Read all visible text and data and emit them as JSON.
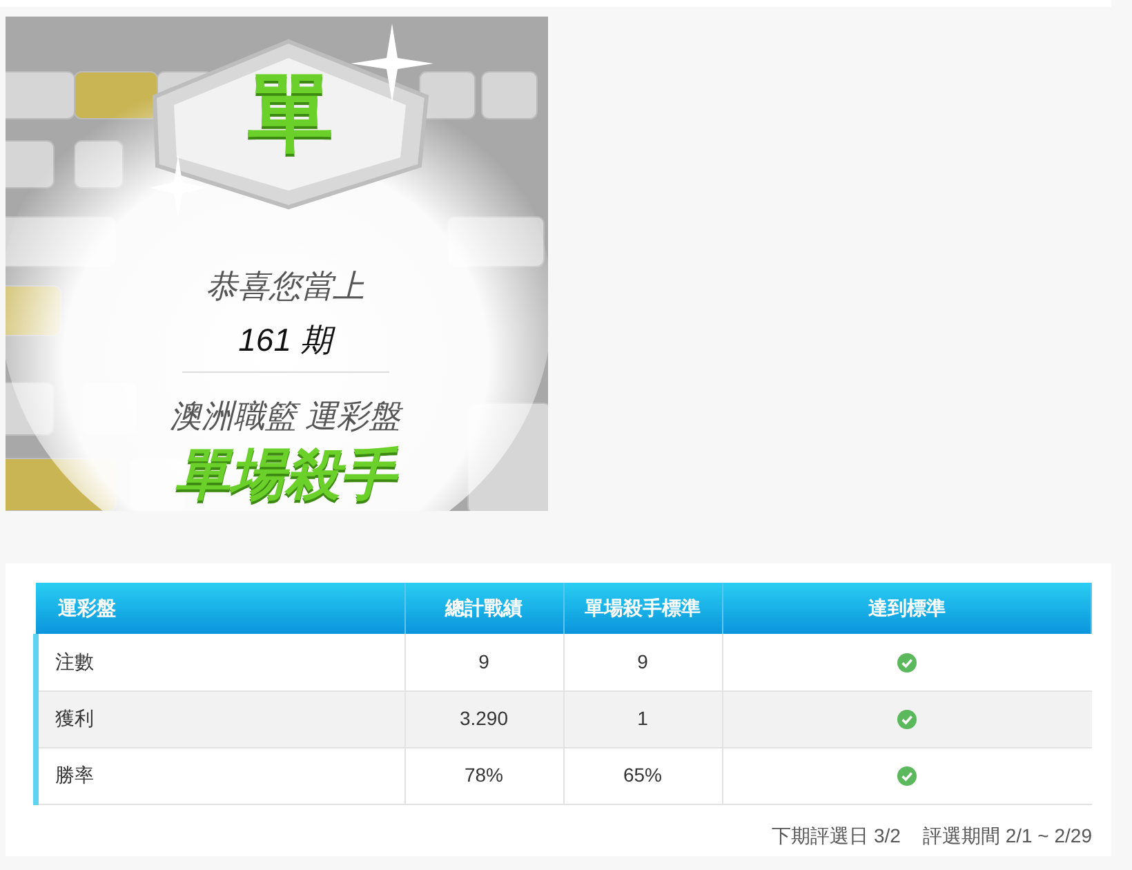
{
  "badge": {
    "emblem": "單",
    "greeting": "恭喜您當上",
    "period": "161 期",
    "league": "澳洲職籃 運彩盤",
    "title": "單場殺手"
  },
  "table": {
    "columns": [
      "運彩盤",
      "總計戰績",
      "單場殺手標準",
      "達到標準"
    ],
    "rows": [
      {
        "label": "注數",
        "total": "9",
        "standard": "9",
        "met": true
      },
      {
        "label": "獲利",
        "total": "3.290",
        "standard": "1",
        "met": true
      },
      {
        "label": "勝率",
        "total": "78%",
        "standard": "65%",
        "met": true
      }
    ]
  },
  "footer": {
    "next_date": "下期評選日 3/2",
    "period": "評選期間 2/1 ~ 2/29"
  }
}
